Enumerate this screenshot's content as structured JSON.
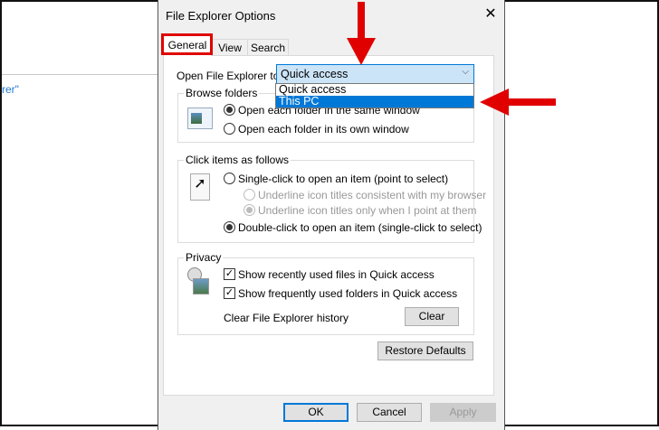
{
  "background": {
    "partial_text": "rer\""
  },
  "dialog": {
    "title": "File Explorer Options",
    "tabs": [
      {
        "label": "General",
        "active": true
      },
      {
        "label": "View"
      },
      {
        "label": "Search"
      }
    ],
    "open_to": {
      "label": "Open File Explorer to:",
      "value": "Quick access",
      "options": [
        "Quick access",
        "This PC"
      ],
      "highlighted": "This PC"
    },
    "browse": {
      "title": "Browse folders",
      "options": [
        "Open each folder in the same window",
        "Open each folder in its own window"
      ],
      "selected": 0
    },
    "click": {
      "title": "Click items as follows",
      "single": "Single-click to open an item (point to select)",
      "sub1": "Underline icon titles consistent with my browser",
      "sub2": "Underline icon titles only when I point at them",
      "double": "Double-click to open an item (single-click to select)"
    },
    "privacy": {
      "title": "Privacy",
      "recent": "Show recently used files in Quick access",
      "frequent": "Show frequently used folders in Quick access",
      "clear_label": "Clear File Explorer history",
      "clear_btn": "Clear"
    },
    "restore": "Restore Defaults",
    "ok": "OK",
    "cancel": "Cancel",
    "apply": "Apply"
  },
  "colors": {
    "accent": "#0078d7",
    "annotation": "#e00000"
  }
}
